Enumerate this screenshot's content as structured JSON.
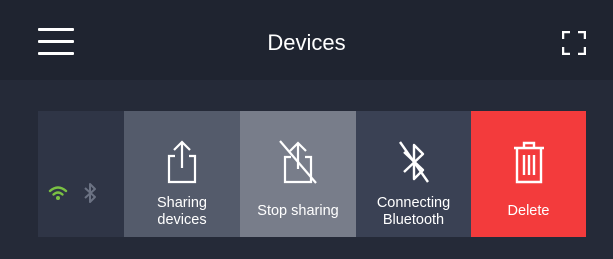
{
  "header": {
    "title": "Devices",
    "menu_icon": "hamburger-menu-icon",
    "fullscreen_icon": "fullscreen-icon"
  },
  "device_row": {
    "status_icons": [
      "wifi-icon",
      "bluetooth-icon"
    ],
    "wifi_color": "#7ac143",
    "bluetooth_color": "#6b7283",
    "actions": [
      {
        "label": "Sharing\ndevices",
        "icon": "share-icon",
        "color": "#545b6b"
      },
      {
        "label": "Stop sharing",
        "icon": "stop-sharing-icon",
        "color": "#787d8a"
      },
      {
        "label": "Connecting\nBluetooth",
        "icon": "bluetooth-disabled-icon",
        "color": "#3a4154"
      },
      {
        "label": "Delete",
        "icon": "trash-icon",
        "color": "#f33b3c"
      }
    ]
  }
}
